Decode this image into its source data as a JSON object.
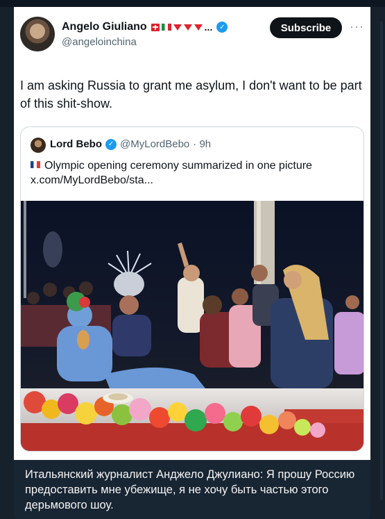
{
  "tweet": {
    "author_name": "Angelo Giuliano",
    "flags_suffix": "...",
    "handle": "@angeloinchina",
    "subscribe_label": "Subscribe",
    "more_label": "···",
    "text": "I am asking Russia to grant me asylum, I don't want to be part of this shit-show."
  },
  "quoted_tweet": {
    "author_name": "Lord Bebo",
    "handle": "@MyLordBebo",
    "time": "· 9h",
    "text_line1": "Olympic opening ceremony summarized in one picture",
    "text_line2": "x.com/MyLordBebo/sta..."
  },
  "message": {
    "caption": "Итальянский журналист Анджело Джулиано: Я прошу Россию предоставить мне убежище, я не хочу быть частью этого дерьмового шоу."
  },
  "colors": {
    "background": "#17212b",
    "message_bubble": "#182533",
    "verified_blue": "#1d9bf0",
    "subscribe_button": "#0f1419"
  },
  "icons": [
    "verified-badge-icon",
    "swiss-flag-icon",
    "italian-flag-icon",
    "red-triangle-icon",
    "french-flag-icon",
    "more-icon"
  ]
}
